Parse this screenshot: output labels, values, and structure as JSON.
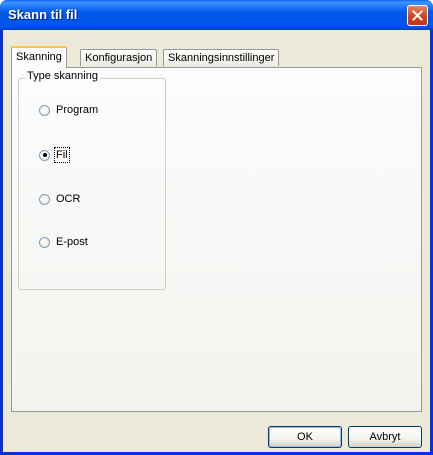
{
  "window": {
    "title": "Skann til fil"
  },
  "tabs": [
    {
      "label": "Skanning",
      "active": true
    },
    {
      "label": "Konfigurasjon",
      "active": false
    },
    {
      "label": "Skanningsinnstillinger",
      "active": false
    }
  ],
  "scan_type": {
    "group_label": "Type skanning",
    "options": [
      {
        "label": "Program",
        "selected": false
      },
      {
        "label": "Fil",
        "selected": true
      },
      {
        "label": "OCR",
        "selected": false
      },
      {
        "label": "E-post",
        "selected": false
      }
    ]
  },
  "buttons": {
    "ok": "OK",
    "cancel": "Avbryt"
  }
}
